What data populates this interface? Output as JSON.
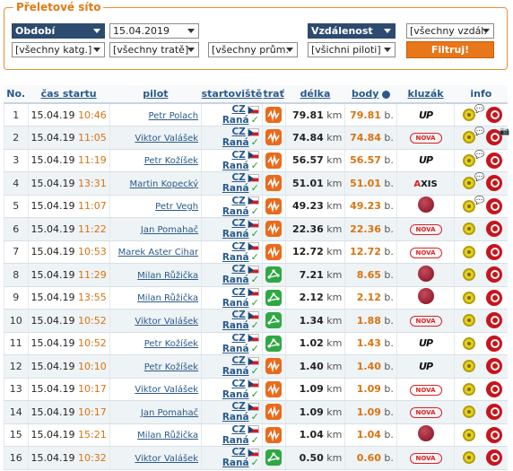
{
  "filter": {
    "legend": "Přeletové síto",
    "period": "Období",
    "date": "15.04.2019",
    "distance": "Vzdálenost",
    "all_distances": "[všechny vzdál.",
    "all_categories": "[všechny katg.]",
    "all_tracks": "[všechny tratě]",
    "all_averages": "[všechny prům.",
    "all_pilots": "[všichni piloti]",
    "filter_button": "Filtruj!"
  },
  "table": {
    "headers": {
      "no": "No.",
      "start_time": "čas startu",
      "pilot": "pilot",
      "launch": "startoviště",
      "track": "trať",
      "length": "délka",
      "points": "body",
      "glider": "kluzák",
      "info": "info"
    },
    "unit_km": "km",
    "unit_pts": "b.",
    "rows": [
      {
        "no": "1",
        "date": "15.04.19",
        "time": "10:46",
        "pilot": "Petr Polach",
        "country": "CZ",
        "site": "Raná",
        "track": "orange",
        "length": "79.81",
        "points": "79.81",
        "glider": "up",
        "chat": true,
        "camera": false
      },
      {
        "no": "2",
        "date": "15.04.19",
        "time": "11:05",
        "pilot": "Viktor Valášek",
        "country": "CZ",
        "site": "Raná",
        "track": "orange",
        "length": "74.84",
        "points": "74.84",
        "glider": "nova",
        "chat": true,
        "camera": true
      },
      {
        "no": "3",
        "date": "15.04.19",
        "time": "11:19",
        "pilot": "Petr Kožíšek",
        "country": "CZ",
        "site": "Raná",
        "track": "orange",
        "length": "56.57",
        "points": "56.57",
        "glider": "up",
        "chat": true,
        "camera": false
      },
      {
        "no": "4",
        "date": "15.04.19",
        "time": "13:31",
        "pilot": "Martin Kopecký",
        "country": "CZ",
        "site": "Raná",
        "track": "orange",
        "length": "51.01",
        "points": "51.01",
        "glider": "axis",
        "chat": true,
        "camera": false
      },
      {
        "no": "5",
        "date": "15.04.19",
        "time": "11:07",
        "pilot": "Petr Vegh",
        "country": "CZ",
        "site": "Raná",
        "track": "orange",
        "length": "49.23",
        "points": "49.23",
        "glider": "dot",
        "chat": true,
        "camera": false
      },
      {
        "no": "6",
        "date": "15.04.19",
        "time": "11:22",
        "pilot": "Jan Pomahač",
        "country": "CZ",
        "site": "Raná",
        "track": "orange",
        "length": "22.36",
        "points": "22.36",
        "glider": "nova",
        "chat": false,
        "camera": false
      },
      {
        "no": "7",
        "date": "15.04.19",
        "time": "10:53",
        "pilot": "Marek Aster Cihar",
        "country": "CZ",
        "site": "Raná",
        "track": "orange",
        "length": "12.72",
        "points": "12.72",
        "glider": "nova",
        "chat": false,
        "camera": false
      },
      {
        "no": "8",
        "date": "15.04.19",
        "time": "11:29",
        "pilot": "Milan Růžička",
        "country": "CZ",
        "site": "Raná",
        "track": "green",
        "length": "7.21",
        "points": "8.65",
        "glider": "dot",
        "chat": false,
        "camera": false
      },
      {
        "no": "9",
        "date": "15.04.19",
        "time": "13:55",
        "pilot": "Milan Růžička",
        "country": "CZ",
        "site": "Raná",
        "track": "green",
        "length": "2.12",
        "points": "2.12",
        "glider": "dot",
        "chat": false,
        "camera": false
      },
      {
        "no": "10",
        "date": "15.04.19",
        "time": "10:52",
        "pilot": "Viktor Valášek",
        "country": "CZ",
        "site": "Raná",
        "track": "green",
        "length": "1.34",
        "points": "1.88",
        "glider": "nova",
        "chat": false,
        "camera": false
      },
      {
        "no": "11",
        "date": "15.04.19",
        "time": "10:52",
        "pilot": "Petr Kožíšek",
        "country": "CZ",
        "site": "Raná",
        "track": "green",
        "length": "1.02",
        "points": "1.43",
        "glider": "up",
        "chat": false,
        "camera": false
      },
      {
        "no": "12",
        "date": "15.04.19",
        "time": "10:10",
        "pilot": "Petr Kožíšek",
        "country": "CZ",
        "site": "Raná",
        "track": "orange",
        "length": "1.40",
        "points": "1.40",
        "glider": "up",
        "chat": false,
        "camera": false
      },
      {
        "no": "13",
        "date": "15.04.19",
        "time": "10:17",
        "pilot": "Viktor Valášek",
        "country": "CZ",
        "site": "Raná",
        "track": "orange",
        "length": "1.09",
        "points": "1.09",
        "glider": "nova",
        "chat": false,
        "camera": false
      },
      {
        "no": "14",
        "date": "15.04.19",
        "time": "10:17",
        "pilot": "Jan Pomahač",
        "country": "CZ",
        "site": "Raná",
        "track": "orange",
        "length": "1.09",
        "points": "1.09",
        "glider": "nova",
        "chat": false,
        "camera": false
      },
      {
        "no": "15",
        "date": "15.04.19",
        "time": "15:21",
        "pilot": "Milan Růžička",
        "country": "CZ",
        "site": "Raná",
        "track": "orange",
        "length": "1.04",
        "points": "1.04",
        "glider": "dot",
        "chat": false,
        "camera": false
      },
      {
        "no": "16",
        "date": "15.04.19",
        "time": "10:32",
        "pilot": "Viktor Valášek",
        "country": "CZ",
        "site": "Raná",
        "track": "green",
        "length": "0.50",
        "points": "0.60",
        "glider": "nova",
        "chat": false,
        "camera": false
      }
    ]
  },
  "glider_logos": {
    "up": "UP",
    "nova": "NOVA",
    "axis_a": "A",
    "axis_b": "XIS"
  },
  "colors": {
    "accent_orange": "#e8761a",
    "header_blue": "#2d4b6e",
    "track_orange": "#ea6a1b",
    "track_green": "#2fa844"
  }
}
